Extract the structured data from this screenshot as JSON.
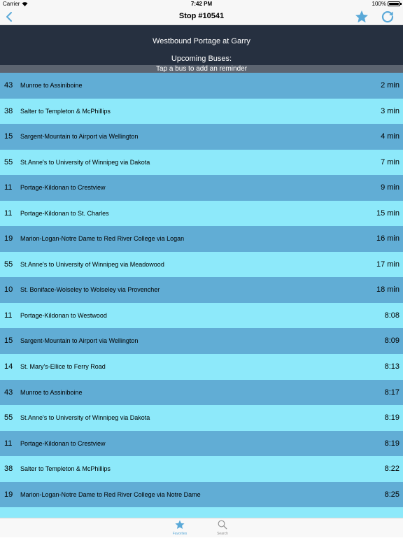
{
  "status_bar": {
    "carrier": "Carrier",
    "time": "7:42 PM",
    "battery": "100%"
  },
  "nav": {
    "title": "Stop #10541",
    "back_icon": "chevron-left-icon",
    "favorite_icon": "star-icon",
    "refresh_icon": "refresh-icon",
    "accent_color": "#5aa9d8"
  },
  "header": {
    "stop_name": "Westbound Portage at Garry",
    "upcoming_label": "Upcoming Buses:",
    "hint": "Tap a bus to add an reminder"
  },
  "colors": {
    "header_bg": "#263040",
    "hint_bg": "#5c6470",
    "row_dark": "#61add5",
    "row_light": "#8de9fa"
  },
  "buses": [
    {
      "number": "43",
      "route": "Munroe to Assiniboine",
      "time": "2 min"
    },
    {
      "number": "38",
      "route": "Salter to Templeton & McPhillips",
      "time": "3 min"
    },
    {
      "number": "15",
      "route": "Sargent-Mountain to Airport via Wellington",
      "time": "4 min"
    },
    {
      "number": "55",
      "route": "St.Anne's to University of Winnipeg via Dakota",
      "time": "7 min"
    },
    {
      "number": "11",
      "route": "Portage-Kildonan to Crestview",
      "time": "9 min"
    },
    {
      "number": "11",
      "route": "Portage-Kildonan to St. Charles",
      "time": "15 min"
    },
    {
      "number": "19",
      "route": "Marion-Logan-Notre Dame to Red River College via Logan",
      "time": "16 min"
    },
    {
      "number": "55",
      "route": "St.Anne's to University of Winnipeg via Meadowood",
      "time": "17 min"
    },
    {
      "number": "10",
      "route": "St. Boniface-Wolseley to Wolseley via Provencher",
      "time": "18 min"
    },
    {
      "number": "11",
      "route": "Portage-Kildonan to Westwood",
      "time": "8:08"
    },
    {
      "number": "15",
      "route": "Sargent-Mountain to Airport via Wellington",
      "time": "8:09"
    },
    {
      "number": "14",
      "route": "St. Mary's-Ellice to Ferry Road",
      "time": "8:13"
    },
    {
      "number": "43",
      "route": "Munroe to Assiniboine",
      "time": "8:17"
    },
    {
      "number": "55",
      "route": "St.Anne's to University of Winnipeg via Dakota",
      "time": "8:19"
    },
    {
      "number": "11",
      "route": "Portage-Kildonan to Crestview",
      "time": "8:19"
    },
    {
      "number": "38",
      "route": "Salter to Templeton & McPhillips",
      "time": "8:22"
    },
    {
      "number": "19",
      "route": "Marion-Logan-Notre Dame to Red River College via Notre Dame",
      "time": "8:25"
    }
  ],
  "tab_bar": {
    "favorites": {
      "label": "Favorites",
      "icon": "star-icon",
      "active": true
    },
    "search": {
      "label": "Search",
      "icon": "search-icon",
      "active": false
    }
  }
}
